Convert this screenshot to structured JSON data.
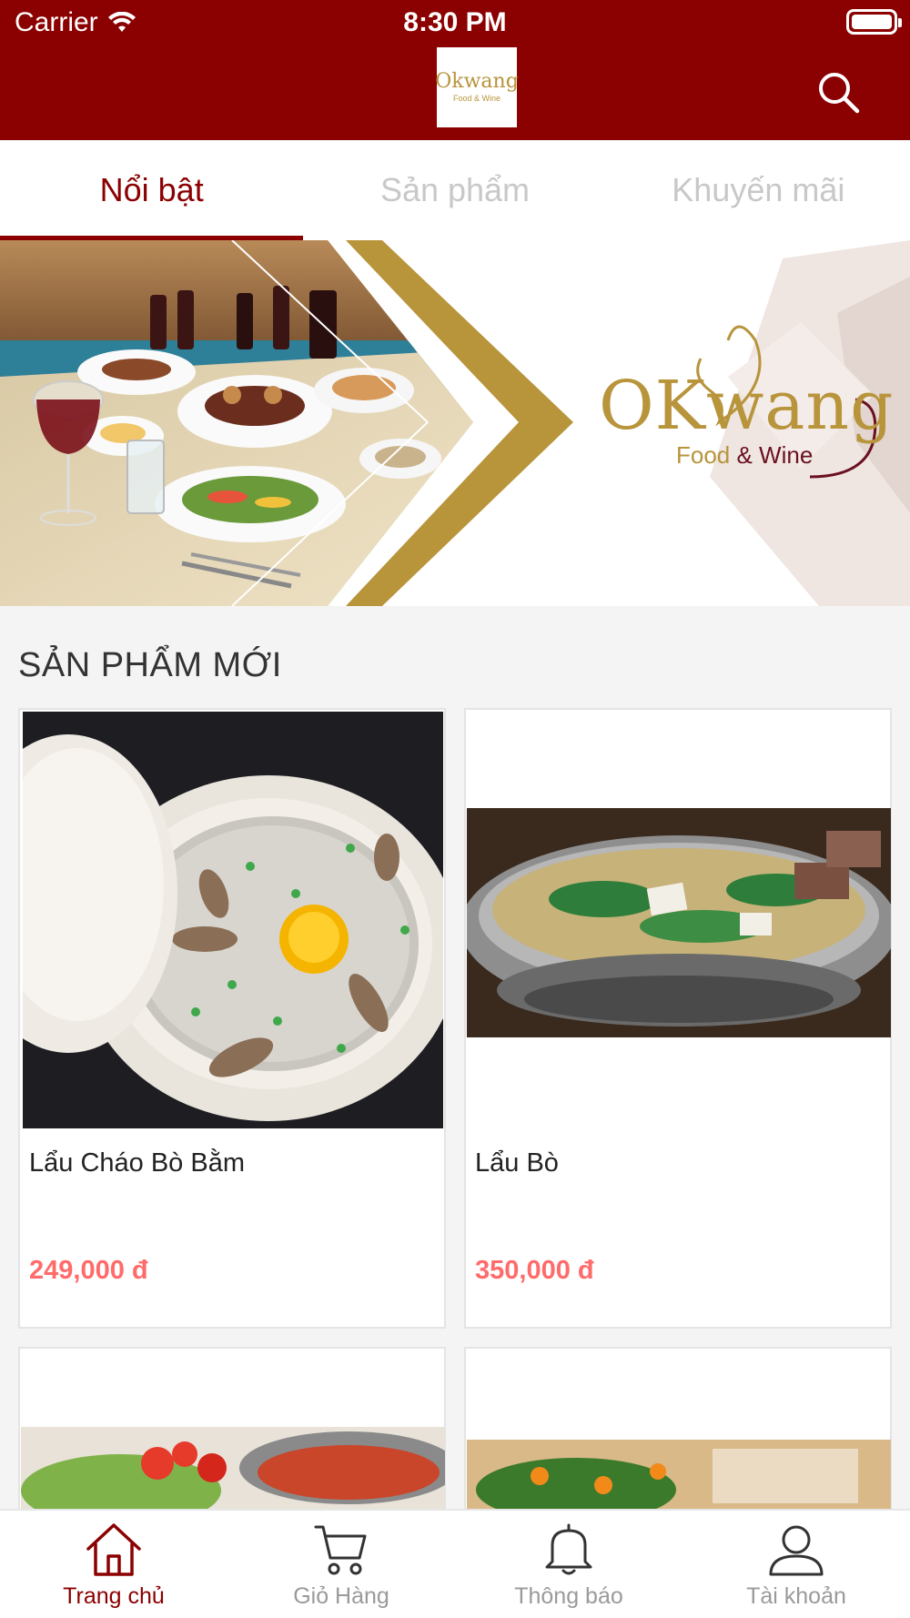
{
  "status": {
    "carrier": "Carrier",
    "time": "8:30 PM"
  },
  "header": {
    "logo_main": "Okwang",
    "logo_sub": "Food & Wine"
  },
  "tabs": [
    {
      "label": "Nổi bật",
      "active": true
    },
    {
      "label": "Sản phẩm",
      "active": false
    },
    {
      "label": "Khuyến mãi",
      "active": false
    }
  ],
  "banner": {
    "logo_main": "OKwang",
    "logo_sub_food": "Food",
    "logo_sub_amp": " & Wine"
  },
  "section": {
    "title": "SẢN PHẨM MỚI"
  },
  "products": [
    {
      "name": "Lẩu Cháo Bò Bằm",
      "price": "249,000 đ"
    },
    {
      "name": "Lẩu Bò",
      "price": "350,000 đ"
    }
  ],
  "bottom_nav": [
    {
      "label": "Trang chủ",
      "icon": "home-icon",
      "active": true
    },
    {
      "label": "Giỏ Hàng",
      "icon": "cart-icon",
      "active": false
    },
    {
      "label": "Thông báo",
      "icon": "bell-icon",
      "active": false
    },
    {
      "label": "Tài khoản",
      "icon": "user-icon",
      "active": false
    }
  ],
  "colors": {
    "brand": "#8b0000",
    "gold": "#b8943b",
    "price": "#ff6b6b"
  }
}
